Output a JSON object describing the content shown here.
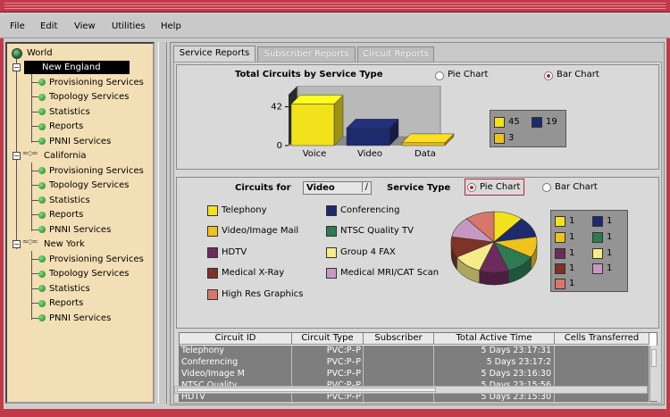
{
  "menu": [
    "File",
    "Edit",
    "View",
    "Utilities",
    "Help"
  ],
  "tree": {
    "root": "World",
    "regions": [
      {
        "name": "New England",
        "selected": true,
        "items": [
          "Provisioning Services",
          "Topology Services",
          "Statistics",
          "Reports",
          "PNNI Services"
        ]
      },
      {
        "name": "California",
        "selected": false,
        "items": [
          "Provisioning Services",
          "Topology Services",
          "Statistics",
          "Reports",
          "PNNI Services"
        ]
      },
      {
        "name": "New York",
        "selected": false,
        "items": [
          "Provisioning Services",
          "Topology Services",
          "Statistics",
          "Reports",
          "PNNI Services"
        ]
      }
    ]
  },
  "tabs": [
    "Service Reports",
    "Subscriber Reports",
    "Circuit Reports"
  ],
  "top_section": {
    "title": "Total Circuits by Service Type",
    "radio_pie": "Pie Chart",
    "radio_bar": "Bar Chart",
    "selected": "Bar Chart",
    "y_tick_top": "42",
    "y_tick_zero": "0",
    "legend": [
      {
        "color": "#f2e21c",
        "value": "45"
      },
      {
        "color": "#1e2a6e",
        "value": "19"
      },
      {
        "color": "#f0c21c",
        "value": "3"
      }
    ]
  },
  "bottom_section": {
    "circuits_for_label": "Circuits for",
    "dropdown_value": "Video",
    "service_type_label": "Service Type",
    "radio_pie": "Pie Chart",
    "radio_bar": "Bar Chart",
    "selected": "Pie Chart",
    "service_types": [
      {
        "name": "Telephony",
        "color": "#f2e21c"
      },
      {
        "name": "Conferencing",
        "color": "#1e2a6e"
      },
      {
        "name": "Video/Image Mail",
        "color": "#f0c21c"
      },
      {
        "name": "NTSC Quality TV",
        "color": "#2e7a52"
      },
      {
        "name": "HDTV",
        "color": "#6e2a5c"
      },
      {
        "name": "Group 4 FAX",
        "color": "#f6eb88"
      },
      {
        "name": "Medical X-Ray",
        "color": "#7e3326"
      },
      {
        "name": "Medical MRI/CAT Scan",
        "color": "#c69ac0"
      },
      {
        "name": "High Res Graphics",
        "color": "#d9766a"
      }
    ],
    "pie_legend": [
      {
        "color": "#f2e21c",
        "value": "1"
      },
      {
        "color": "#1e2a6e",
        "value": "1"
      },
      {
        "color": "#f0c21c",
        "value": "1"
      },
      {
        "color": "#2e7a52",
        "value": "1"
      },
      {
        "color": "#6e2a5c",
        "value": "1"
      },
      {
        "color": "#f6eb88",
        "value": "1"
      },
      {
        "color": "#7e3326",
        "value": "1"
      },
      {
        "color": "#c69ac0",
        "value": "1"
      },
      {
        "color": "#d9766a",
        "value": "1"
      }
    ]
  },
  "table": {
    "columns": [
      "Circuit ID",
      "Circuit Type",
      "Subscriber",
      "Total Active Time",
      "Cells Transferred"
    ],
    "rows": [
      [
        "Telephony",
        "PVC:P–P",
        "",
        "5 Days 23:17:31",
        ""
      ],
      [
        "Conferencing",
        "PVC:P–P",
        "",
        "5 Days 23:17:2",
        ""
      ],
      [
        "Video/Image M",
        "PVC:P–P",
        "",
        "5 Days 23:16:30",
        ""
      ],
      [
        "NTSC Quality",
        "PVC:P–P",
        "",
        "5 Days 23:15:56",
        ""
      ],
      [
        "HDTV",
        "PVC:P–P",
        "",
        "5 Days 23:15:30",
        ""
      ]
    ]
  },
  "chart_data": [
    {
      "type": "bar",
      "title": "Total Circuits by Service Type",
      "categories": [
        "Voice",
        "Video",
        "Data"
      ],
      "values": [
        45,
        19,
        3
      ],
      "colors": [
        "#f2e21c",
        "#1e2a6e",
        "#f0c21c"
      ],
      "yticks": [
        0,
        42
      ],
      "ylim": [
        0,
        60
      ],
      "legend_position": "right"
    },
    {
      "type": "pie",
      "title": "Circuits for Video",
      "categories": [
        "Telephony",
        "Conferencing",
        "Video/Image Mail",
        "NTSC Quality TV",
        "HDTV",
        "Group 4 FAX",
        "Medical X-Ray",
        "Medical MRI/CAT Scan",
        "High Res Graphics"
      ],
      "values": [
        1,
        1,
        1,
        1,
        1,
        1,
        1,
        1,
        1
      ],
      "colors": [
        "#f2e21c",
        "#1e2a6e",
        "#f0c21c",
        "#2e7a52",
        "#6e2a5c",
        "#f6eb88",
        "#7e3326",
        "#c69ac0",
        "#d9766a"
      ],
      "legend_position": "right"
    }
  ]
}
